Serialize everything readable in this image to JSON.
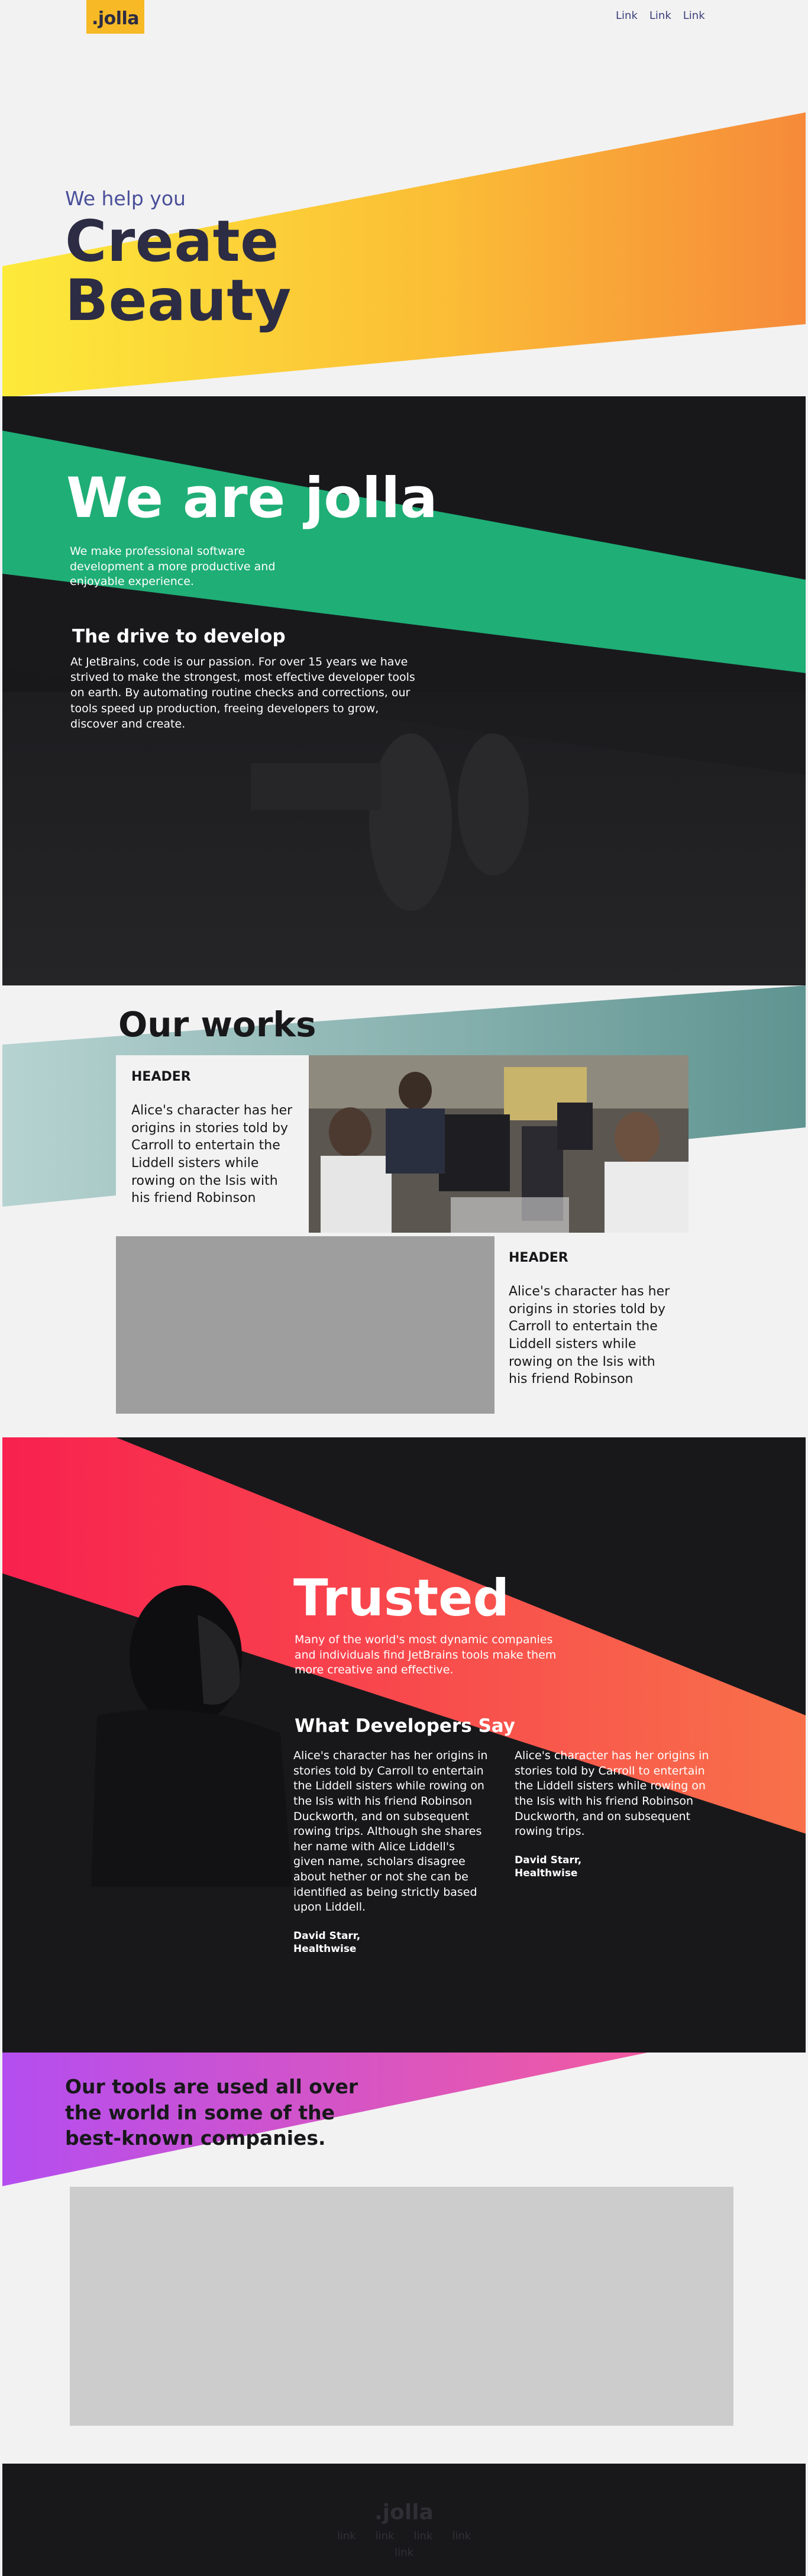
{
  "header": {
    "logo": ".jolla",
    "nav": [
      "Link",
      "Link",
      "Link"
    ]
  },
  "hero": {
    "subtitle": "We help you",
    "title_line1": "Create",
    "title_line2": "Beauty"
  },
  "about": {
    "title": "We are jolla",
    "lead": "We make professional software development a more productive and enjoyable experience.",
    "drive_title": "The drive to develop",
    "drive_text": "At JetBrains, code is our passion. For over 15 years we have strived to make the strongest, most effective developer tools on earth. By automating routine checks and corrections, our tools speed up production, freeing developers to grow, discover and create."
  },
  "works": {
    "title": "Our works",
    "tiles": [
      {
        "header": "HEADER",
        "body": "Alice's character has her origins in stories told by Carroll to entertain the Liddell sisters while rowing on the Isis with his friend Robinson"
      },
      {
        "header": "HEADER",
        "body": "Alice's character has her origins in stories told by Carroll to entertain the Liddell sisters while rowing on the Isis with his friend Robinson"
      }
    ]
  },
  "trusted": {
    "title": "Trusted",
    "lead": "Many of the world's most dynamic companies and individuals find JetBrains tools make them more creative and effective.",
    "section_title": "What Developers Say",
    "quotes": [
      {
        "text": "Alice's character has her origins in stories told by Carroll to entertain the Liddell sisters while rowing on the Isis with his friend Robinson Duckworth, and on subsequent rowing trips. Although she shares her name with Alice Liddell's given name, scholars disagree about hether or not she can be identified as being strictly based upon Liddell.",
        "author": "David Starr,",
        "company": "Healthwise"
      },
      {
        "text": "Alice's character has her origins in stories told by Carroll to entertain the Liddell sisters while rowing on the Isis with his friend Robinson Duckworth, and on subsequent rowing trips.",
        "author": "David Starr,",
        "company": "Healthwise"
      }
    ]
  },
  "customers": {
    "title": "Our tools are used all over the world in some of the best-known companies."
  },
  "footer": {
    "logo": ".jolla",
    "links": [
      "link",
      "link",
      "link",
      "link"
    ],
    "links_row2": [
      "link"
    ]
  },
  "colors": {
    "dark": "#18181b",
    "navy": "#2c2c44",
    "logo_yellow": "#f7b926",
    "hero_gradient": [
      "#fdea3a",
      "#f68a3a"
    ],
    "green_band": "#1fae76",
    "teal_band": "#6fa3a1",
    "red_gradient": [
      "#f8214f",
      "#f8714a"
    ],
    "purple_gradient": [
      "#b44ef0",
      "#f25aa0"
    ]
  }
}
